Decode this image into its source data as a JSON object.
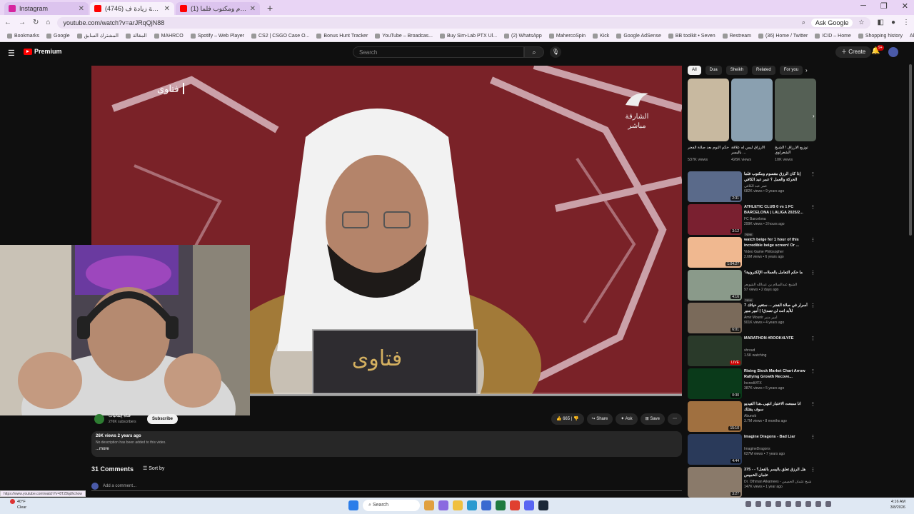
{
  "browser": {
    "tabs": [
      {
        "title": "Instagram",
        "active": false,
        "color": "#d6249f"
      },
      {
        "title": "(4746) هل دوام الزوجة زيادة ف...",
        "active": true,
        "color": "#ff0000"
      },
      {
        "title": "(1) الرزق مقسوم ومكتوب فلما...",
        "active": false,
        "color": "#ff0000"
      }
    ],
    "url": "youtube.com/watch?v=arJRqQjN88",
    "ask_google": "Ask Google",
    "bookmarks": [
      "Bookmarks",
      "Google",
      "المشترك السابق",
      "المقالة",
      "MAHRCO",
      "Spotify – Web Player",
      "CS2 | CSGO Case O...",
      "Bonus Hunt Tracker",
      "YouTube – Broadcas...",
      "Buy Sim-Lab PTX Ul...",
      "(2) WhatsApp",
      "MahercoSpin",
      "Kick",
      "Google AdSense",
      "BB toolkit • Seven",
      "Restream",
      "(36) Home / Twitter",
      "ICID – Home",
      "Shopping history"
    ],
    "all_bookmarks": "All Bookmarks"
  },
  "youtube": {
    "logo": "Premium",
    "search_placeholder": "Search",
    "create": "Create",
    "notifications": "9+",
    "video": {
      "overlay_title": "فتاوى",
      "channel_logo": "الشارقة مباشر"
    },
    "channel": {
      "name": "قناة إيمانيات",
      "subscribers": "276K subscribers",
      "subscribe": "Subscribe"
    },
    "actions": {
      "likes": "665",
      "share": "Share",
      "ask": "Ask",
      "save": "Save"
    },
    "description": {
      "views_date": "26K views  2 years ago",
      "text": "No description has been added to this video.",
      "more": "...more"
    },
    "comments": {
      "count": "31 Comments",
      "sort": "Sort by",
      "add_placeholder": "Add a comment..."
    },
    "chips": [
      "All",
      "Dua",
      "Sheikh",
      "Related",
      "For you"
    ],
    "shorts": [
      {
        "title": "حكم النوم بعد صلاة الفجر",
        "views": "537K views",
        "color": "#c8b9a0"
      },
      {
        "title": "الأرزاق ليس له علاقة باليسر ...",
        "views": "426K views",
        "color": "#8aa0b0"
      },
      {
        "title": "توزيع الارزاق ! الشيخ الشعراوي",
        "views": "10K views",
        "color": "#556055"
      }
    ],
    "videos": [
      {
        "title": "إذا كان الرزق مقسوم ومكتوب فلما الحركة والعمل ؟ عمر عبد الكافي",
        "channel": "عمر عبد الكافي",
        "stats": "682K views • 9 years ago",
        "duration": "2:31",
        "thumb": "#5a6a8a",
        "badge": ""
      },
      {
        "title": "ATHLETIC CLUB 0 vs 1 FC BARCELONA | LALIGA 2025/2...",
        "channel": "FC Barcelona",
        "stats": "299K views • 3 hours ago",
        "duration": "3:12",
        "thumb": "#7a2030",
        "badge": "New"
      },
      {
        "title": "watch beige for 1 hour of this incredible beige screen! Or ...",
        "channel": "Video Game Philosopher",
        "stats": "2.6M views • 6 years ago",
        "duration": "1:04:27",
        "thumb": "#f0b890",
        "badge": ""
      },
      {
        "title": "ما حكم التعامل بالعملات الإلكترونية؟",
        "channel": "الشيخ عبدالسلام بن عبدالله الشويعر",
        "stats": "97 views • 2 days ago",
        "duration": "4:16",
        "thumb": "#8a9a8a",
        "badge": "New"
      },
      {
        "title": "7 أسرار في صلاة الفجر ... ستغير حياتك للأبد انت لن تصدق! | أمير منير",
        "channel": "Amir Mounir أمير منير",
        "stats": "901K views • 4 years ago",
        "duration": "6:01",
        "thumb": "#7a6a5a",
        "badge": ""
      },
      {
        "title": "MARATHON #ROOK4LYFE",
        "channel": "shroud",
        "stats": "1.5K watching",
        "duration": "LIVE",
        "thumb": "#2a3a2a",
        "badge": ""
      },
      {
        "title": "Rising Stock Market Chart Arrow Rallying Growth Recove...",
        "channel": "IncrediVFX",
        "stats": "387K views • 5 years ago",
        "duration": "0:30",
        "thumb": "#0a3a1a",
        "badge": ""
      },
      {
        "title": "انا سمعت الاختبار انتهى..هذا الفيديو سوف يقتلك",
        "channel": "Abunob",
        "stats": "3.7M views • 8 months ago",
        "duration": "15:10",
        "thumb": "#a07040",
        "badge": ""
      },
      {
        "title": "Imagine Dragons - Bad Liar",
        "channel": "ImagineDragons",
        "stats": "627M views • 7 years ago",
        "duration": "4:44",
        "thumb": "#2a3a5a",
        "badge": ""
      },
      {
        "title": "375 - هل الرزق تعلق باليسر بالفعل؟ - عثمان الخميس",
        "channel": "Dr. Othman Alkamees - الشيخ عثمان الخميس",
        "stats": "147K views • 1 year ago",
        "duration": "3:27",
        "thumb": "#8a7a6a",
        "badge": ""
      }
    ]
  },
  "status": {
    "url_hover": "https://www.youtube.com/watch?v=8TZ8qdhchow"
  },
  "taskbar": {
    "temp": "40°F",
    "weather": "Clear",
    "search": "Search",
    "time": "4:16 AM",
    "date": "3/8/2026"
  }
}
